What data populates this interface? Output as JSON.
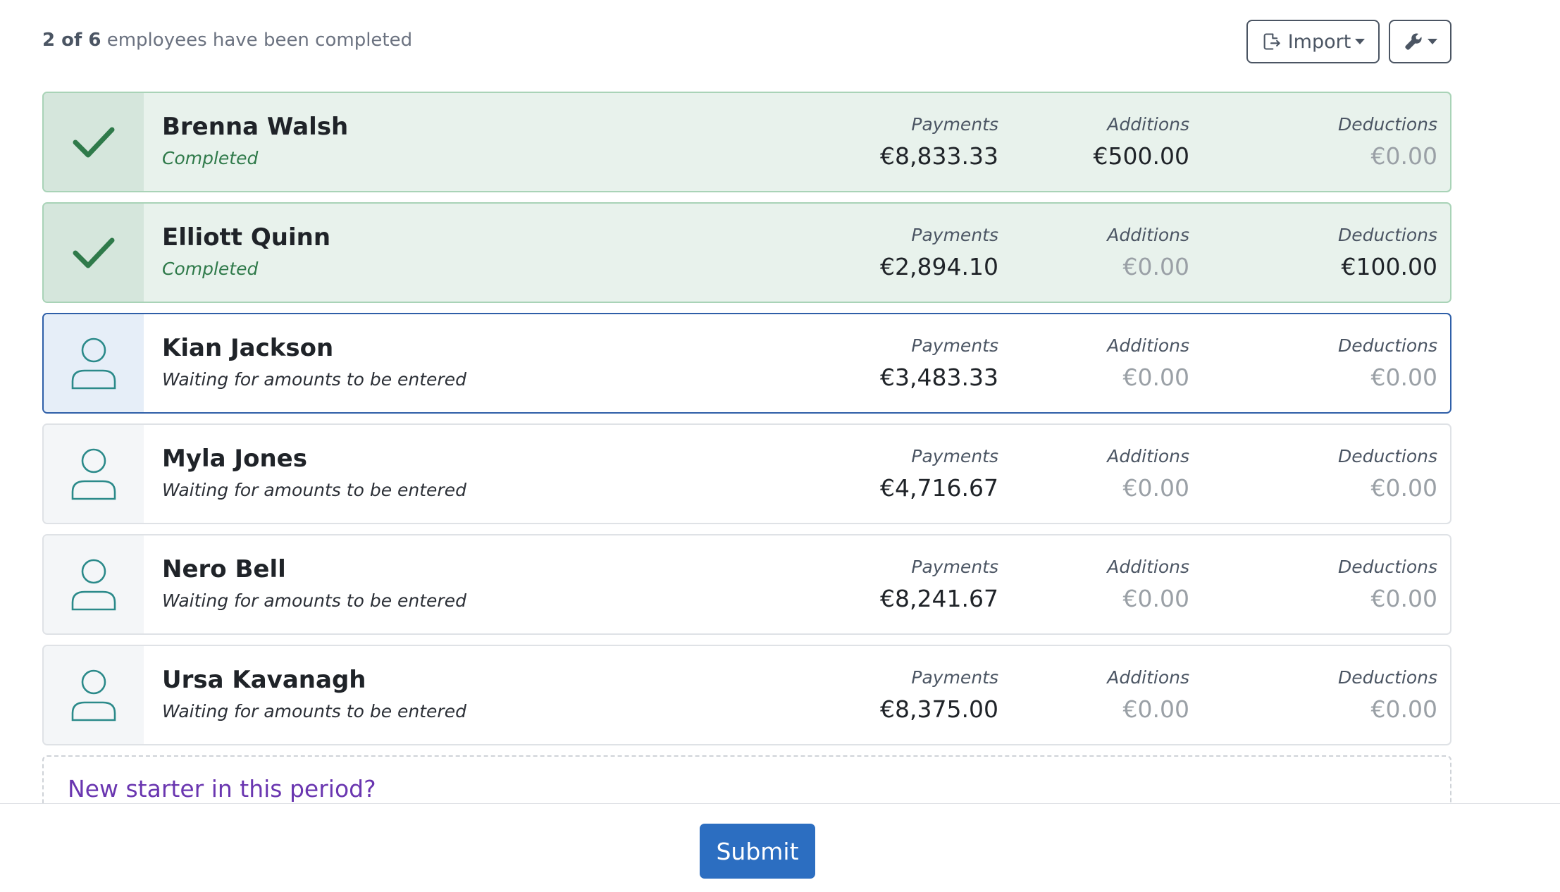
{
  "header": {
    "summary_count": "2 of 6",
    "summary_text": "employees have been completed",
    "import_label": "Import",
    "import_icon": "export-icon",
    "tools_icon": "wrench-icon"
  },
  "columns": {
    "payments": "Payments",
    "additions": "Additions",
    "deductions": "Deductions"
  },
  "employees": [
    {
      "name": "Brenna Walsh",
      "status": "Completed",
      "state": "completed",
      "payments": "€8,833.33",
      "additions": "€500.00",
      "deductions": "€0.00"
    },
    {
      "name": "Elliott Quinn",
      "status": "Completed",
      "state": "completed",
      "payments": "€2,894.10",
      "additions": "€0.00",
      "deductions": "€100.00"
    },
    {
      "name": "Kian Jackson",
      "status": "Waiting for amounts to be entered",
      "state": "active",
      "payments": "€3,483.33",
      "additions": "€0.00",
      "deductions": "€0.00"
    },
    {
      "name": "Myla Jones",
      "status": "Waiting for amounts to be entered",
      "state": "pending",
      "payments": "€4,716.67",
      "additions": "€0.00",
      "deductions": "€0.00"
    },
    {
      "name": "Nero Bell",
      "status": "Waiting for amounts to be entered",
      "state": "pending",
      "payments": "€8,241.67",
      "additions": "€0.00",
      "deductions": "€0.00"
    },
    {
      "name": "Ursa Kavanagh",
      "status": "Waiting for amounts to be entered",
      "state": "pending",
      "payments": "€8,375.00",
      "additions": "€0.00",
      "deductions": "€0.00"
    }
  ],
  "new_starter_link": "New starter in this period?",
  "footer": {
    "submit_label": "Submit"
  },
  "colors": {
    "completed_bg": "#e8f2ec",
    "completed_check": "#2f7a4a",
    "active_border": "#2f5fa8",
    "person_icon": "#2b8a8a",
    "submit": "#2c6ec1",
    "link": "#6a36b0"
  }
}
